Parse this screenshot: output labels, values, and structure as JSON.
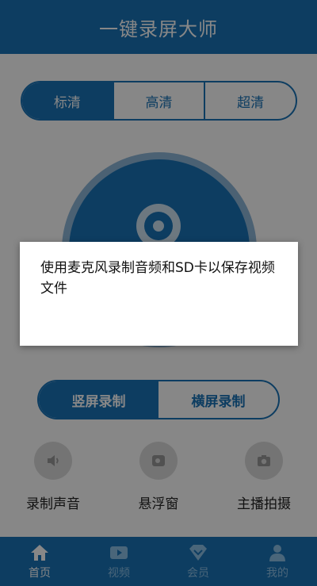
{
  "header": {
    "title": "一键录屏大师"
  },
  "quality": {
    "options": [
      {
        "label": "标清",
        "active": true
      },
      {
        "label": "高清",
        "active": false
      },
      {
        "label": "超清",
        "active": false
      }
    ]
  },
  "orientation": {
    "options": [
      {
        "label": "竖屏录制",
        "active": true
      },
      {
        "label": "横屏录制",
        "active": false
      }
    ]
  },
  "features": [
    {
      "label": "录制声音",
      "icon": "speaker-icon"
    },
    {
      "label": "悬浮窗",
      "icon": "floating-window-icon"
    },
    {
      "label": "主播拍摄",
      "icon": "camera-icon"
    }
  ],
  "nav": {
    "items": [
      {
        "label": "首页",
        "icon": "home-icon",
        "active": true
      },
      {
        "label": "视频",
        "icon": "video-icon",
        "active": false
      },
      {
        "label": "会员",
        "icon": "vip-icon",
        "active": false
      },
      {
        "label": "我的",
        "icon": "profile-icon",
        "active": false
      }
    ]
  },
  "dialog": {
    "message": "使用麦克风录制音频和SD卡以保存视频文件"
  },
  "colors": {
    "primary": "#1a73b8",
    "overlay": "rgba(0,0,0,0.47)"
  }
}
